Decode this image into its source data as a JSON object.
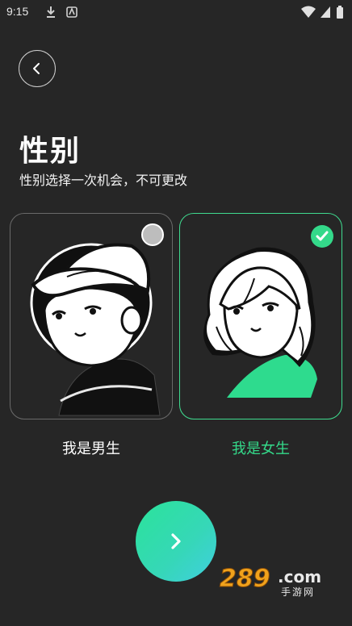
{
  "status_bar": {
    "time": "9:15"
  },
  "header": {
    "title": "性别",
    "subtitle": "性别选择一次机会，不可更改"
  },
  "options": [
    {
      "label": "我是男生",
      "selected": false
    },
    {
      "label": "我是女生",
      "selected": true
    }
  ],
  "colors": {
    "background": "#262626",
    "accent": "#34d98a"
  },
  "icons": {
    "back": "chevron-left-icon",
    "next": "chevron-right-icon",
    "selected": "check-icon"
  },
  "watermark": {
    "number": "289",
    "domain": ".com",
    "tagline": "手游网"
  }
}
